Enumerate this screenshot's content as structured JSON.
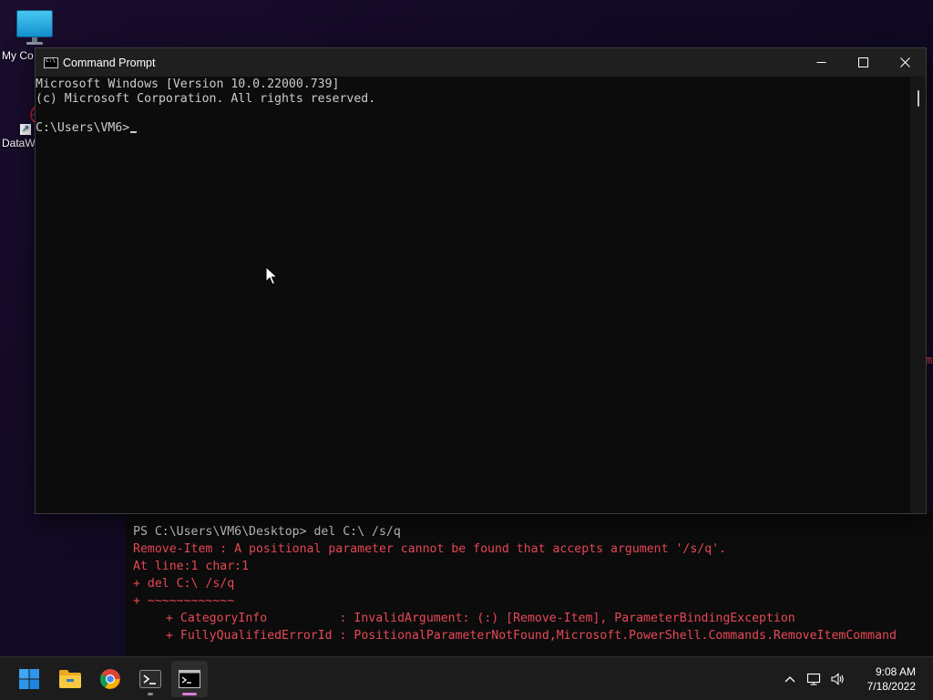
{
  "desktop": {
    "icons": [
      {
        "label": "My Co",
        "icon": "monitor-icon"
      },
      {
        "label": "DataW",
        "icon": "datawizard-icon"
      }
    ]
  },
  "cmd_window": {
    "title": "Command Prompt",
    "lines": [
      "Microsoft Windows [Version 10.0.22000.739]",
      "(c) Microsoft Corporation. All rights reserved.",
      "",
      "C:\\Users\\VM6>"
    ]
  },
  "powershell": {
    "prompt_line": "PS C:\\Users\\VM6\\Desktop> del C:\\ /s/q",
    "error_lines": [
      "Remove-Item : A positional parameter cannot be found that accepts argument '/s/q'.",
      "At line:1 char:1",
      "+ del C:\\ /s/q",
      "+ ~~~~~~~~~~~~"
    ],
    "detail_lines": [
      "+ CategoryInfo          : InvalidArgument: (:) [Remove-Item], ParameterBindingException",
      "+ FullyQualifiedErrorId : PositionalParameterNotFound,Microsoft.PowerShell.Commands.RemoveItemCommand"
    ],
    "edge_fragment": "m"
  },
  "taskbar": {
    "apps": [
      {
        "name": "start",
        "icon": "windows-start-icon"
      },
      {
        "name": "file-explorer",
        "icon": "folder-icon"
      },
      {
        "name": "chrome",
        "icon": "chrome-icon"
      },
      {
        "name": "powershell",
        "icon": "powershell-icon"
      },
      {
        "name": "command-prompt",
        "icon": "cmd-icon"
      }
    ],
    "clock_time": "9:08 AM",
    "clock_date": "7/18/2022"
  }
}
